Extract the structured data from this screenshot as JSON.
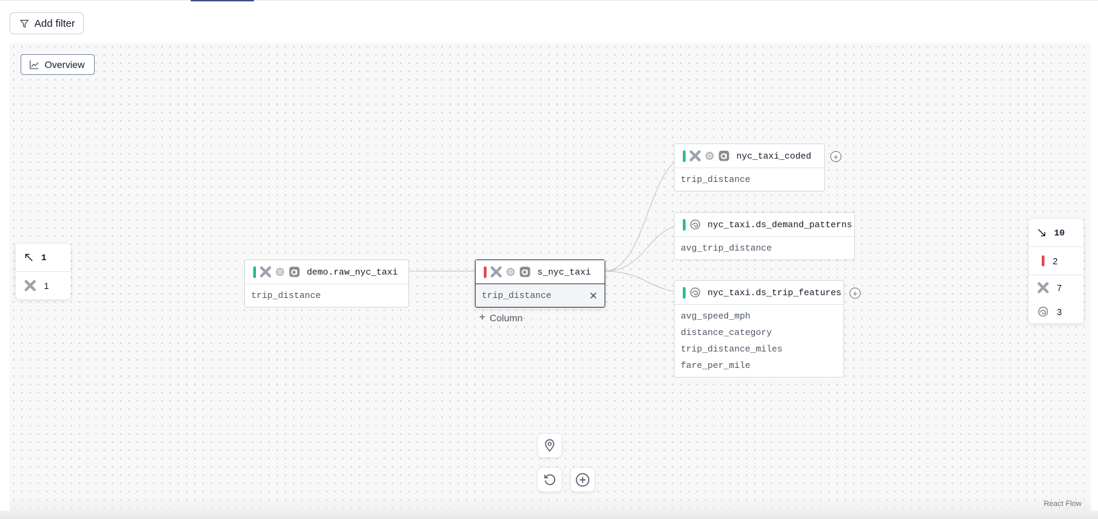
{
  "toolbar": {
    "add_filter_label": "Add filter"
  },
  "canvas": {
    "overview_label": "Overview",
    "attribution": "React Flow"
  },
  "nodes": {
    "source": {
      "title": "demo.raw_nyc_taxi",
      "status": "green",
      "columns": [
        "trip_distance"
      ]
    },
    "center": {
      "title": "s_nyc_taxi",
      "status": "red",
      "columns": [
        "trip_distance"
      ],
      "add_column_label": "Column"
    },
    "coded": {
      "title": "nyc_taxi_coded",
      "status": "green",
      "columns": [
        "trip_distance"
      ]
    },
    "demand": {
      "title": "nyc_taxi.ds_demand_patterns",
      "status": "green",
      "columns": [
        "avg_trip_distance"
      ]
    },
    "features": {
      "title": "nyc_taxi.ds_trip_features",
      "status": "green",
      "columns": [
        "avg_speed_mph",
        "distance_category",
        "trip_distance_miles",
        "fare_per_mile"
      ]
    }
  },
  "left_panel": {
    "upstream_count": "1",
    "dbt_count": "1"
  },
  "right_panel": {
    "downstream_count": "10",
    "error_count": "2",
    "dbt_count": "7",
    "swirl_count": "3"
  },
  "colors": {
    "ok": "#2ab996",
    "error": "#e5484d",
    "selected_border": "#2c3440"
  },
  "icons": [
    "filter-icon",
    "chart-line-icon",
    "dbt-icon",
    "snowflake-icon",
    "airflow-icon",
    "swirl-icon",
    "arrow-up-left-icon",
    "arrow-down-right-icon",
    "location-icon",
    "reset-icon",
    "zoom-in-icon",
    "plus-circle-icon",
    "close-icon"
  ]
}
